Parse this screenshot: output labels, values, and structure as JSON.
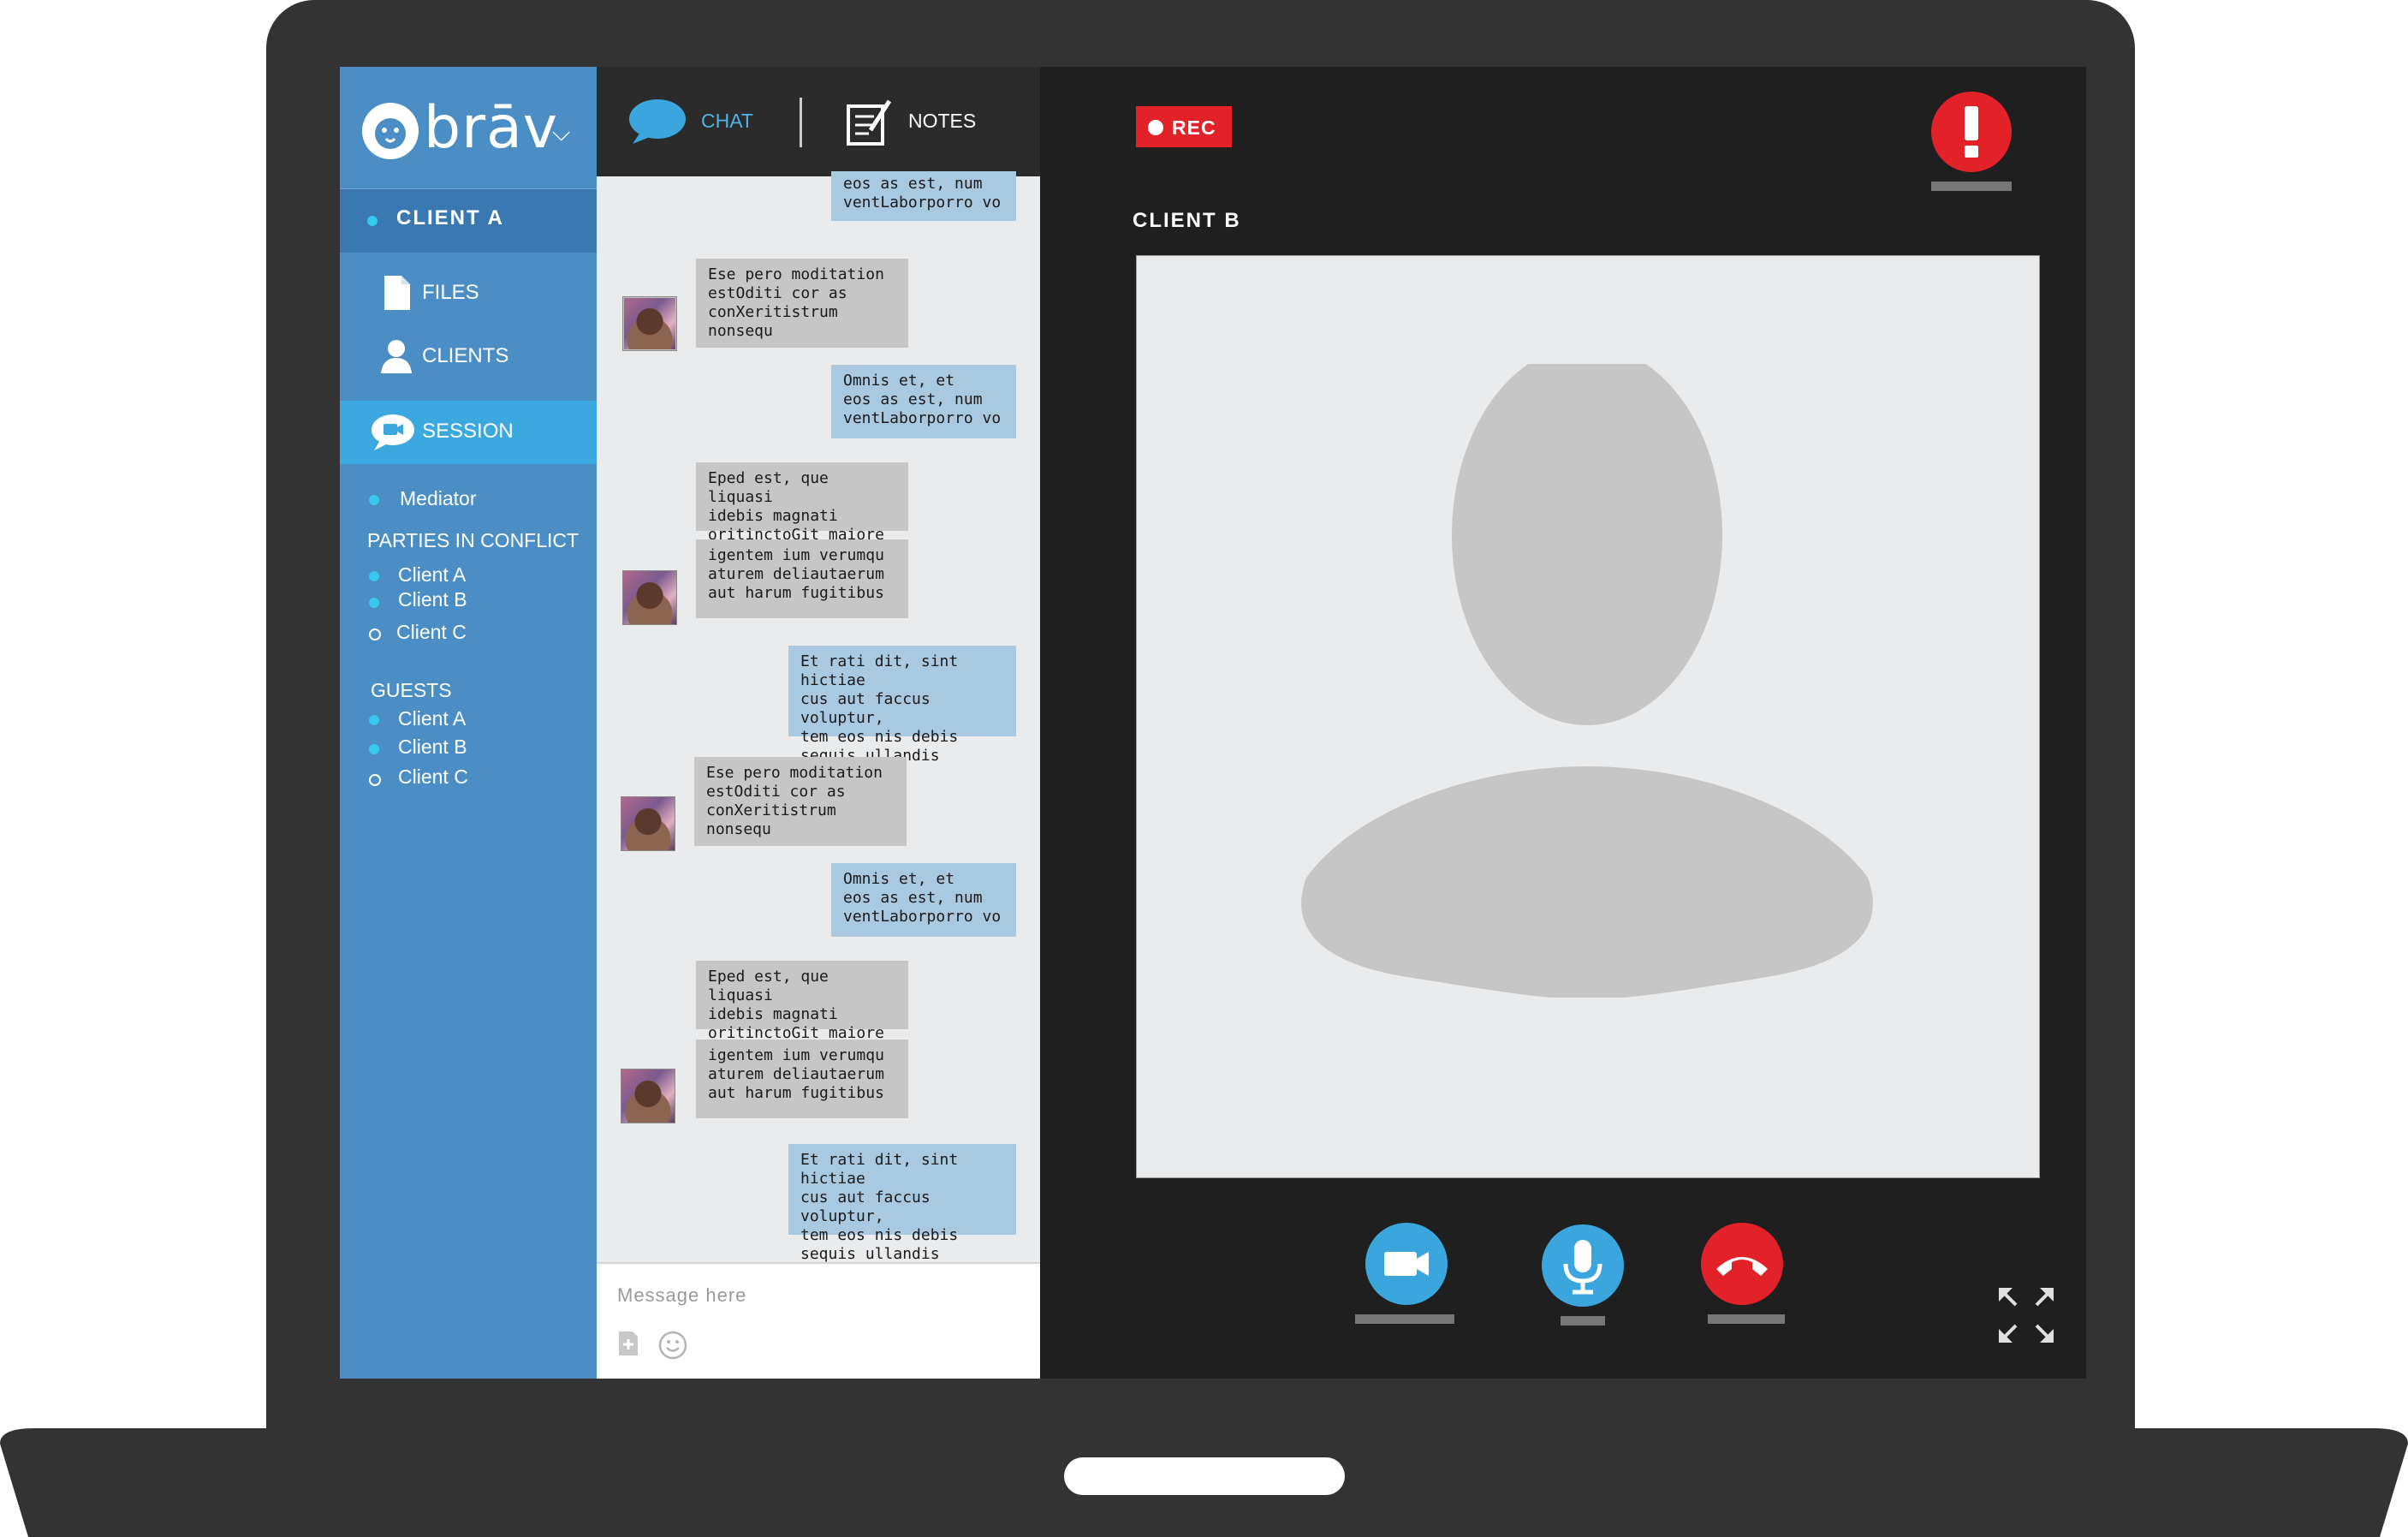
{
  "app": {
    "logo_text": "brāv",
    "client_header": "CLIENT A"
  },
  "nav": {
    "files": "FILES",
    "clients": "CLIENTS",
    "session": "SESSION"
  },
  "participants": {
    "mediator": "Mediator",
    "parties_title": "PARTIES IN CONFLICT",
    "parties": [
      {
        "name": "Client A",
        "online": true
      },
      {
        "name": "Client B",
        "online": true
      },
      {
        "name": "Client C",
        "online": false
      }
    ],
    "guests_title": "GUESTS",
    "guests": [
      {
        "name": "Client A",
        "online": true
      },
      {
        "name": "Client B",
        "online": true
      },
      {
        "name": "Client C",
        "online": false
      }
    ]
  },
  "chat": {
    "tab_chat": "CHAT",
    "tab_notes": "NOTES",
    "messages": [
      {
        "from": "out",
        "lines": [
          "eos as est, num",
          "ventLaborporro vo"
        ]
      },
      {
        "from": "in",
        "lines": [
          "Ese pero moditation",
          "estOditi cor as",
          "conXeritistrum",
          "nonsequ"
        ]
      },
      {
        "from": "out",
        "lines": [
          "Omnis et, et",
          "eos as est, num",
          "ventLaborporro vo"
        ]
      },
      {
        "from": "in",
        "lines": [
          "Eped est, que liquasi",
          "idebis magnati",
          "oritinctoGit maiore"
        ]
      },
      {
        "from": "in",
        "lines": [
          "igentem ium verumqu",
          "aturem deliautaerum",
          "aut harum fugitibus"
        ]
      },
      {
        "from": "out",
        "lines": [
          "Et rati dit, sint hictiae",
          "cus aut faccus voluptur,",
          "tem eos nis debis",
          "sequis ullandis elesPor"
        ]
      },
      {
        "from": "in",
        "lines": [
          "Ese pero moditation",
          "estOditi cor as",
          "conXeritistrum",
          "nonsequ"
        ]
      },
      {
        "from": "out",
        "lines": [
          "Omnis et, et",
          "eos as est, num",
          "ventLaborporro vo"
        ]
      },
      {
        "from": "in",
        "lines": [
          "Eped est, que liquasi",
          "idebis magnati",
          "oritinctoGit maiore"
        ]
      },
      {
        "from": "in",
        "lines": [
          "igentem ium verumqu",
          "aturem deliautaerum",
          "aut harum fugitibus"
        ]
      },
      {
        "from": "out",
        "lines": [
          "Et rati dit, sint hictiae",
          "cus aut faccus voluptur,",
          "tem eos nis debis",
          "sequis ullandis elesPor"
        ]
      }
    ],
    "input_placeholder": "Message here"
  },
  "video": {
    "rec_label": "REC",
    "participant_name": "CLIENT B"
  },
  "colors": {
    "sidebar": "#4a8ec5",
    "sidebar_active": "#3ca8e0",
    "accent_cyan": "#35c8f0",
    "rec_red": "#e32129",
    "control_blue": "#3aa6dd",
    "incoming_bubble": "#c6c6c6",
    "outgoing_bubble": "#a9c9e0"
  },
  "icons": {
    "video_control": "video-camera-icon",
    "mic_control": "microphone-icon",
    "hangup_control": "phone-hangup-icon",
    "alert": "exclamation-icon",
    "fullscreen": "fullscreen-icon"
  }
}
